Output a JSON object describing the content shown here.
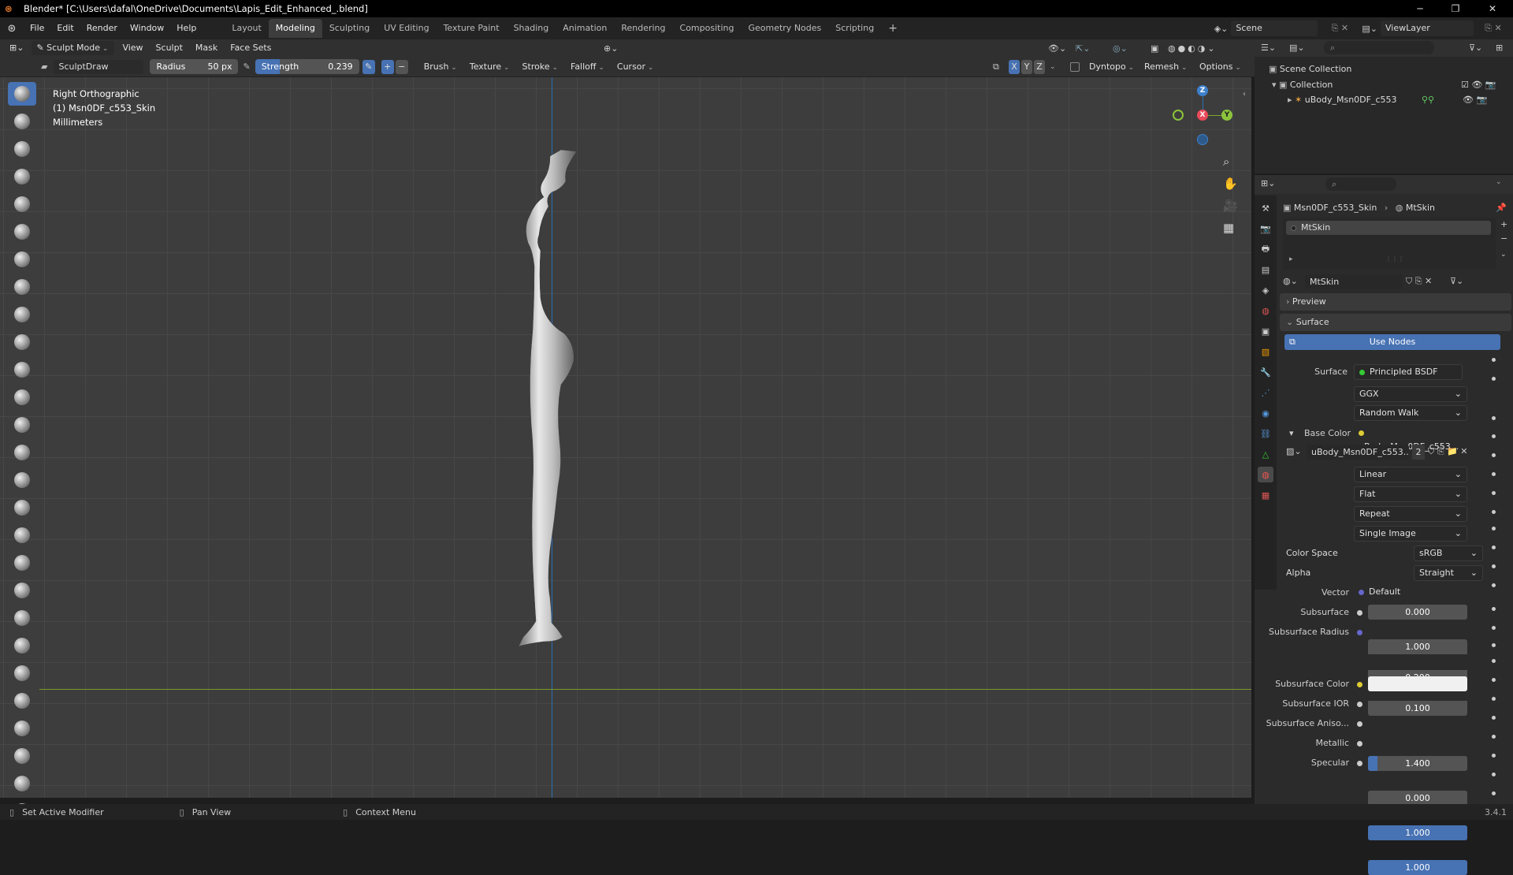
{
  "window": {
    "title": "Blender* [C:\\Users\\dafal\\OneDrive\\Documents\\Lapis_Edit_Enhanced_.blend]",
    "minimize": "─",
    "maximize": "❐",
    "close": "✕"
  },
  "menu": [
    "File",
    "Edit",
    "Render",
    "Window",
    "Help"
  ],
  "workspaces": [
    "Layout",
    "Modeling",
    "Sculpting",
    "UV Editing",
    "Texture Paint",
    "Shading",
    "Animation",
    "Rendering",
    "Compositing",
    "Geometry Nodes",
    "Scripting"
  ],
  "workspace_add": "+",
  "scene": {
    "name": "Scene",
    "view_layer": "ViewLayer"
  },
  "viewport_header": {
    "mode": "Sculpt Mode",
    "menus": [
      "View",
      "Sculpt",
      "Mask",
      "Face Sets"
    ]
  },
  "tool_settings": {
    "brush_name": "SculptDraw",
    "radius_label": "Radius",
    "radius_value": "50 px",
    "strength_label": "Strength",
    "strength_value": "0.239",
    "strength_fraction": 0.239,
    "plus": "+",
    "minus": "−",
    "dropdowns": [
      "Brush",
      "Texture",
      "Stroke",
      "Falloff",
      "Cursor"
    ],
    "axes": [
      "X",
      "Y",
      "Z"
    ],
    "dyntopo": "Dyntopo",
    "remesh": "Remesh",
    "options": "Options"
  },
  "viewport": {
    "view_name": "Right Orthographic",
    "object_name": "(1) Msn0DF_c553_Skin",
    "units": "Millimeters",
    "gizmo": {
      "z": "Z",
      "x": "X",
      "y": "Y"
    }
  },
  "outliner": {
    "scene_collection": "Scene Collection",
    "collection": "Collection",
    "object": "uBody_Msn0DF_c553"
  },
  "properties": {
    "breadcrumb_object": "Msn0DF_c553_Skin",
    "breadcrumb_material": "MtSkin",
    "slot_name": "MtSkin",
    "material_name": "MtSkin",
    "panel_preview": "Preview",
    "panel_surface": "Surface",
    "use_nodes": "Use Nodes",
    "surface_label": "Surface",
    "surface_value": "Principled BSDF",
    "distribution": "GGX",
    "subsurface_method": "Random Walk",
    "base_color_label": "Base Color",
    "base_color_value": "uBody_Msn0DF_c553...",
    "image_name": "uBody_Msn0DF_c553...",
    "image_users": "2",
    "interpolation": "Linear",
    "projection": "Flat",
    "extension": "Repeat",
    "source": "Single Image",
    "color_space_label": "Color Space",
    "color_space_value": "sRGB",
    "alpha_label": "Alpha",
    "alpha_value": "Straight",
    "vector_label": "Vector",
    "vector_value": "Default",
    "subsurface_label": "Subsurface",
    "subsurface_value": "0.000",
    "subsurface_radius_label": "Subsurface Radius",
    "subsurface_radius": [
      "1.000",
      "0.200",
      "0.100"
    ],
    "subsurface_color_label": "Subsurface Color",
    "subsurface_ior_label": "Subsurface IOR",
    "subsurface_ior_value": "1.400",
    "subsurface_aniso_label": "Subsurface Aniso...",
    "subsurface_aniso_value": "0.000",
    "metallic_label": "Metallic",
    "metallic_value": "1.000",
    "specular_label": "Specular",
    "specular_value": "1.000"
  },
  "statusbar": {
    "left": "Set Active Modifier",
    "middle": "Pan View",
    "right": "Context Menu",
    "version": "3.4.1"
  },
  "colors": {
    "accent": "#4772b3",
    "background": "#3d3d3d"
  }
}
